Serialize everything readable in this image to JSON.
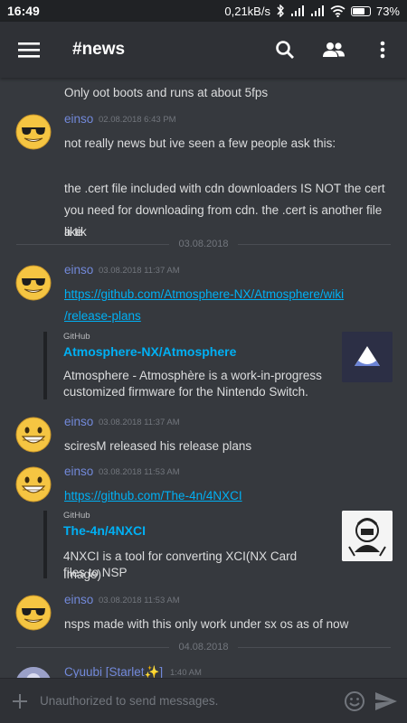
{
  "status_bar": {
    "time": "16:49",
    "net_speed": "0,21kB/s",
    "battery_pct": "73%",
    "icons": [
      "bluetooth-icon",
      "signal-icon",
      "signal-icon",
      "wifi-icon",
      "battery-icon"
    ]
  },
  "header": {
    "channel": "#news",
    "icons": [
      "hamburger-menu-icon",
      "search-icon",
      "members-icon",
      "overflow-menu-icon"
    ]
  },
  "messages": [
    {
      "text": "Only oot boots and runs at about 5fps"
    },
    {
      "author": "einso",
      "time": "02.08.2018 6:43 PM",
      "text1": "not really news but ive seen a few people ask this:",
      "text2a": "the .cert file included with cdn downloaders IS NOT the cert",
      "text2b": "you need for downloading from cdn. the .cert is another file like",
      "text2c": "a tik"
    },
    {
      "author": "einso",
      "time": "03.08.2018 11:37 AM",
      "link_a": "https://github.com/Atmosphere-NX/Atmosphere/wiki",
      "link_b": "/release-plans",
      "embed": {
        "provider": "GitHub",
        "title": "Atmosphere-NX/Atmosphere",
        "desc_a": "Atmosphere - Atmosphère is a work-in-progress",
        "desc_b": "customized firmware for the Nintendo Switch."
      }
    },
    {
      "author": "einso",
      "time": "03.08.2018 11:37 AM",
      "text": "sciresM released his release plans"
    },
    {
      "author": "einso",
      "time": "03.08.2018 11:53 AM",
      "link": "https://github.com/The-4n/4NXCI",
      "embed": {
        "provider": "GitHub",
        "title": "The-4n/4NXCI",
        "desc_a": "4NXCI is a tool for converting XCI(NX Card Image)",
        "desc_b": "files to NSP"
      }
    },
    {
      "author": "einso",
      "time": "03.08.2018 11:53 AM",
      "text": "nsps made with this only work under sx os as of now"
    },
    {
      "author": "Cyuubi [Starlet✨]",
      "time": "1:40 AM"
    }
  ],
  "dividers": [
    "03.08.2018",
    "04.08.2018"
  ],
  "composer": {
    "placeholder": "Unauthorized to send messages.",
    "icons": [
      "add-icon",
      "emoji-icon",
      "send-icon"
    ]
  },
  "colors": {
    "background": "#36393e",
    "header": "#2f3136",
    "author": "#7289da",
    "link": "#00b0f4",
    "text": "#dcddde",
    "muted": "#72767d"
  }
}
